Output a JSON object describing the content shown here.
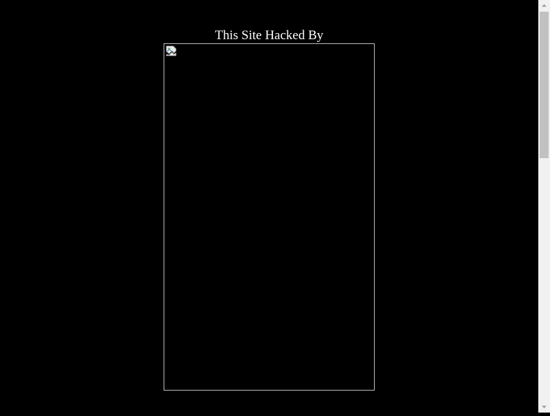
{
  "page": {
    "background": "#000000",
    "text_color": "#ffffff"
  },
  "headline": {
    "text": "This Site Hacked By"
  },
  "image": {
    "state": "broken",
    "icon": "broken-image-icon",
    "border_color": "#c0c0c0"
  },
  "scrollbar": {
    "icons": {
      "up": "arrow-up-icon",
      "down": "arrow-down-icon"
    },
    "track_color": "#f1f1f1",
    "thumb_color": "#c1c1c1"
  }
}
